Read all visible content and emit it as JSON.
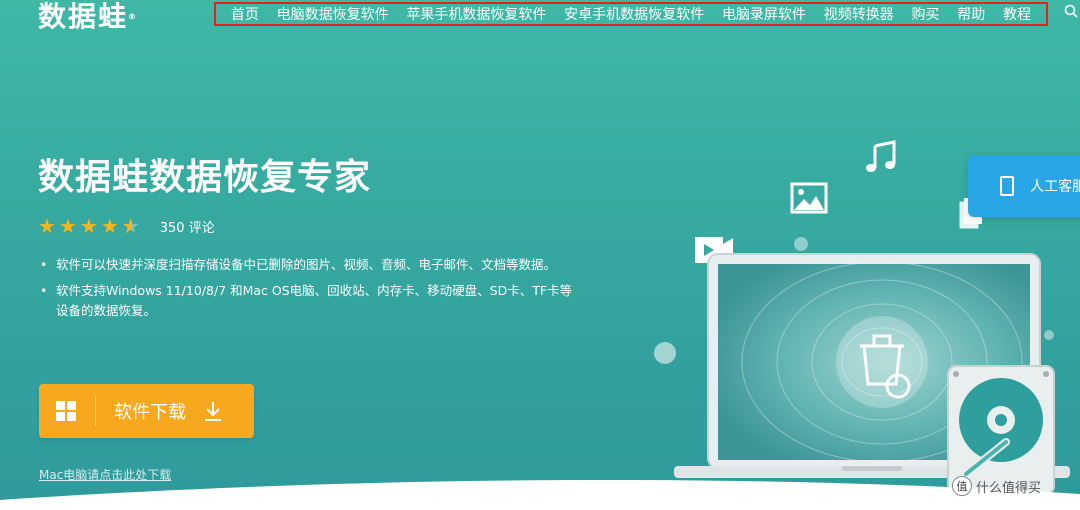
{
  "logo": {
    "text": "数据蛙",
    "mark": "®"
  },
  "nav": {
    "items": [
      "首页",
      "电脑数据恢复软件",
      "苹果手机数据恢复软件",
      "安卓手机数据恢复软件",
      "电脑录屏软件",
      "视频转换器",
      "购买",
      "帮助",
      "教程"
    ]
  },
  "hero": {
    "title": "数据蛙数据恢复专家",
    "rating": 4.5,
    "reviews": "350 评论",
    "bullets": [
      "软件可以快速并深度扫描存储设备中已删除的图片、视频、音频、电子邮件、文档等数据。",
      "软件支持Windows 11/10/8/7 和Mac OS电脑、回收站、内存卡、移动硬盘、SD卡、TF卡等设备的数据恢复。"
    ],
    "download_label": "软件下载",
    "mac_link": "Mac电脑请点击此处下载"
  },
  "side": {
    "customer_service": "人工客服"
  },
  "watermark": {
    "badge": "值",
    "text": "什么值得买"
  },
  "colors": {
    "accent": "#f7a81e",
    "bg_top": "#3fb8a6",
    "bg_bottom": "#2f9a9c",
    "service_btn": "#28a6e6",
    "highlight_border": "#e0231f"
  }
}
